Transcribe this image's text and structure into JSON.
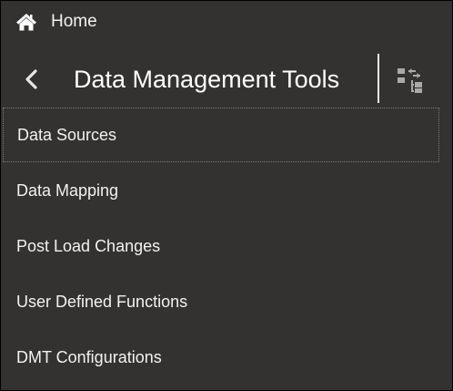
{
  "header": {
    "home_label": "Home",
    "title": "Data Management Tools",
    "home_icon": "home-icon",
    "back_icon": "chevron-left-icon",
    "switch_icon": "switch-hierarchy-icon"
  },
  "nav": {
    "items": [
      {
        "label": "Data Sources",
        "focused": true
      },
      {
        "label": "Data Mapping"
      },
      {
        "label": "Post Load Changes"
      },
      {
        "label": "User Defined Functions"
      },
      {
        "label": "DMT Configurations"
      }
    ]
  },
  "colors": {
    "background": "#333230",
    "text": "#ffffff",
    "divider": "#e8e8e8",
    "focus_outline": "#7a7a7a"
  }
}
